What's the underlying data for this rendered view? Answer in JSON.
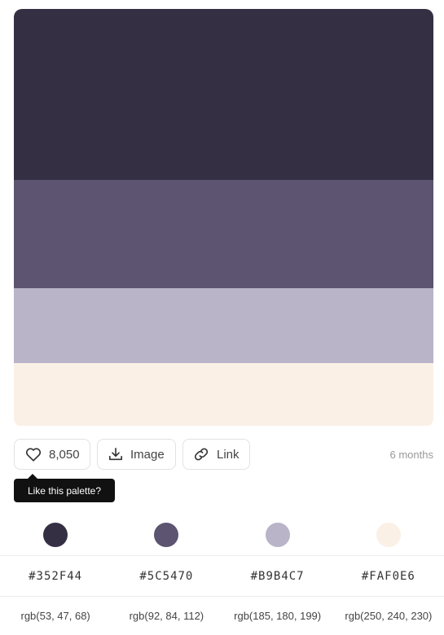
{
  "palette": {
    "colors": [
      {
        "hex": "#352F44",
        "rgb": "rgb(53, 47, 68)",
        "share": 0.41
      },
      {
        "hex": "#5C5470",
        "rgb": "rgb(92, 84, 112)",
        "share": 0.26
      },
      {
        "hex": "#B9B4C7",
        "rgb": "rgb(185, 180, 199)",
        "share": 0.18
      },
      {
        "hex": "#FAF0E6",
        "rgb": "rgb(250, 240, 230)",
        "share": 0.15
      }
    ]
  },
  "actions": {
    "like_icon": "heart-icon",
    "like_count": "8,050",
    "image_icon": "download-icon",
    "image_label": "Image",
    "link_icon": "link-icon",
    "link_label": "Link",
    "age": "6 months"
  },
  "tooltip": {
    "text": "Like this palette?"
  }
}
